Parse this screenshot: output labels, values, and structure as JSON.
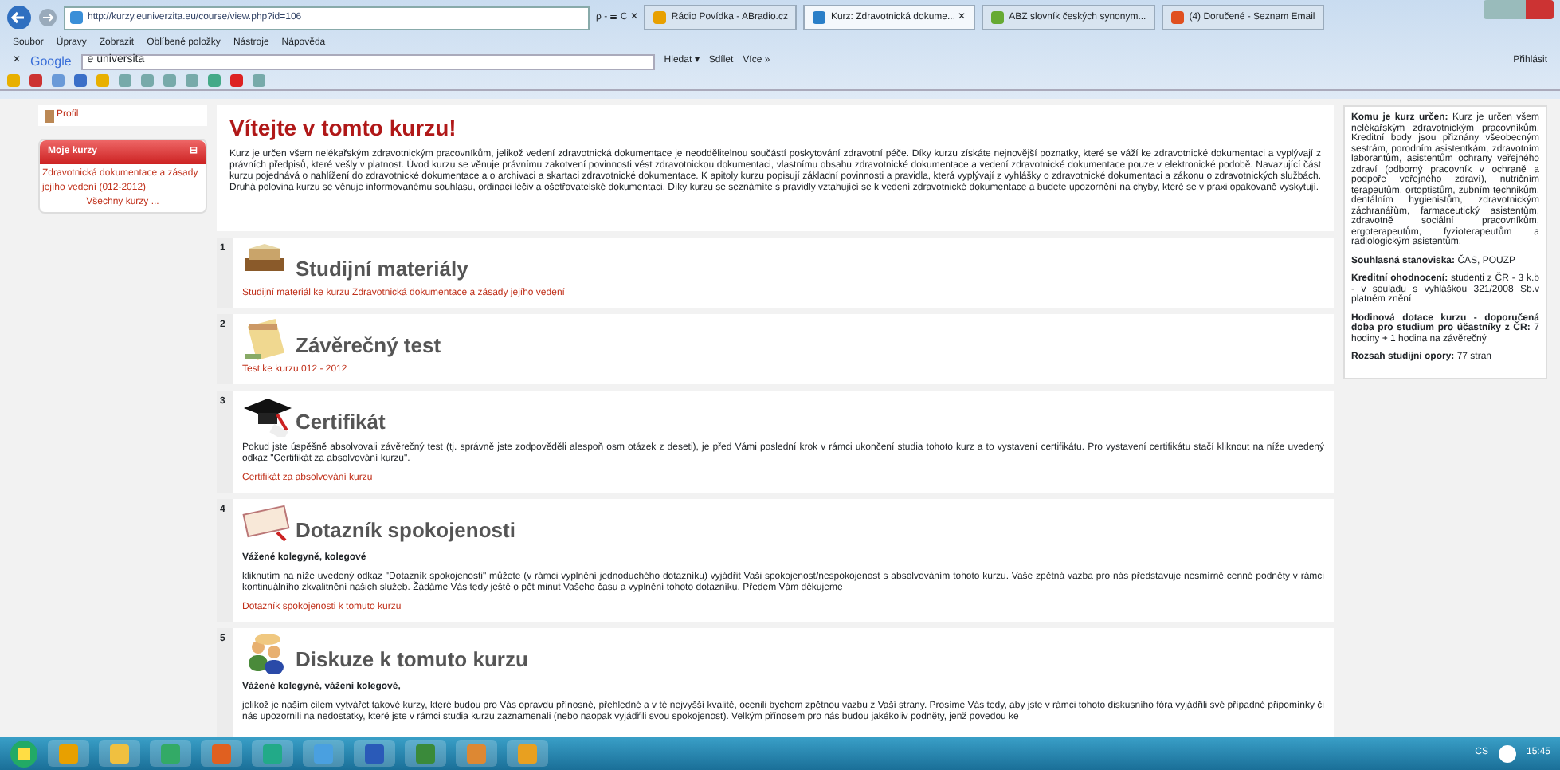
{
  "browser": {
    "address": "http://kurzy.euniverzita.eu/course/view.php?id=106",
    "search_controls": "ρ - ≣ C ✕",
    "tabs": [
      {
        "label": "Rádio Povídka - ABradio.cz",
        "selected": false
      },
      {
        "label": "Kurz: Zdravotnická dokume... ✕",
        "selected": true
      },
      {
        "label": "ABZ slovník českých synonym...",
        "selected": false
      },
      {
        "label": "(4) Doručené - Seznam Email",
        "selected": false
      }
    ],
    "menu": [
      "Soubor",
      "Úpravy",
      "Zobrazit",
      "Oblíbené položky",
      "Nástroje",
      "Nápověda"
    ],
    "toolbar": {
      "close": "✕",
      "brand": "Google",
      "query": "e universita",
      "buttons": [
        "Hledat ▾",
        "Sdílet",
        "Více »"
      ],
      "login": "Přihlásit"
    }
  },
  "sidebar": {
    "profile": "Profil",
    "block": {
      "title": "Moje kurzy",
      "collapse": "⊟",
      "course": "Zdravotnická dokumentace a zásady jejího vedení (012-2012)",
      "all": "Všechny kurzy ..."
    }
  },
  "intro": {
    "title": "Vítejte v tomto kurzu!",
    "text": "Kurz je určen všem nelékařským zdravotnickým pracovníkům, jelikož vedení zdravotnická dokumentace je neoddělitelnou součástí poskytování zdravotní péče. Díky kurzu získáte nejnovější poznatky, které se váží ke zdravotnické dokumentaci a vyplývají z právních předpisů, které vešly v platnost. Úvod kurzu se věnuje právnímu zakotvení povinnosti vést zdravotnickou dokumentaci, vlastnímu obsahu zdravotnické dokumentace a vedení zdravotnické dokumentace pouze v elektronické podobě. Navazující část kurzu pojednává o nahlížení do zdravotnické dokumentace a o archivaci a skartaci zdravotnické dokumentace. K apitoly kurzu popisují základní povinnosti a pravidla, která vyplývají z vyhlášky o zdravotnické dokumentaci a zákonu o zdravotnických službách. Druhá polovina kurzu se věnuje informovanému souhlasu, ordinaci léčiv a ošetřovatelské dokumentaci. Díky kurzu se seznámíte s pravidly vztahující se k vedení zdravotnické dokumentace a budete upozornění na chyby, které se v praxi opakovaně vyskytují."
  },
  "sections": [
    {
      "number": "1",
      "kind": "book",
      "title": "Studijní materiály",
      "link": "Studijní materiál ke kurzu Zdravotnická dokumentace a zásady jejího vedení"
    },
    {
      "number": "2",
      "kind": "notepad",
      "title": "Závěrečný test",
      "link": "Test ke kurzu 012 - 2012"
    },
    {
      "number": "3",
      "kind": "cap",
      "title": "Certifikát",
      "text": "Pokud jste úspěšně absolvovali závěrečný test (tj. správně jste zodpověděli alespoň osm otázek z deseti), je před Vámi poslední krok v rámci ukončení studia tohoto kurz a to vystavení certifikátu. Pro vystavení certifikátu stačí kliknout na níže uvedený odkaz \"Certifikát za absolvování kurzu\".",
      "link": "Certifikát za absolvování kurzu"
    },
    {
      "number": "4",
      "kind": "clipboard",
      "title": "Dotazník spokojenosti",
      "greeting": "Vážené kolegyně, kolegové",
      "text": "kliknutím na níže uvedený odkaz \"Dotazník spokojenosti\" můžete (v rámci vyplnění jednoduchého dotazníku) vyjádřit Vaši spokojenost/nespokojenost s absolvováním tohoto kurzu. Vaše zpětná vazba pro nás představuje nesmírně cenné podněty v rámci kontinuálního zkvalitnění našich služeb. Žádáme Vás tedy ještě o pět minut Vašeho času a vyplnění tohoto dotazníku. Předem Vám děkujeme",
      "link": "Dotazník spokojenosti k tomuto kurzu"
    },
    {
      "number": "5",
      "kind": "people",
      "title": "Diskuze k tomuto kurzu",
      "greeting": "Vážené kolegyně, vážení kolegové,",
      "text": "jelikož je naším cílem vytvářet takové kurzy, které budou pro Vás opravdu přínosné, přehledné a v té nejvyšší kvalitě, ocenili bychom zpětnou vazbu z Vaší strany. Prosíme Vás tedy, aby jste v rámci tohoto diskusního fóra vyjádřili své případné připomínky či nás upozornili na nedostatky, které jste v rámci studia kurzu zaznamenali (nebo naopak vyjádřili svou spokojenost). Velkým přínosem pro nás budou jakékoliv podněty, jenž povedou ke"
    }
  ],
  "info": [
    "**Komu je kurz určen:** Kurz je určen všem nelékařským zdravotnickým pracovníkům. Kreditní body jsou přiznány všeobecným sestrám, porodním asistentkám, zdravotním laborantům, asistentům ochrany veřejného zdraví (odborný pracovník v ochraně a podpoře veřejného zdraví), nutričním terapeutům, ortoptistům, zubním technikům, dentálním hygienistům, zdravotnickým záchranářům, farmaceutický asistentům, zdravotně sociální pracovníkům, ergoterapeutům, fyzioterapeutům a radiologickým asistentům.",
    "**Souhlasná stanoviska:** ČAS, POUZP",
    "**Kreditní ohodnocení:** studenti z ČR - 3 k.b - v souladu s vyhláškou 321/2008 Sb.v platném znění",
    "**Hodinová dotace kurzu - doporučená doba pro studium pro účastníky z ČR:** 7 hodiny + 1 hodina na závěrečný",
    "**Rozsah studijní opory:** 77 stran"
  ],
  "taskbar": {
    "language": "CS",
    "clock": "15:45"
  }
}
